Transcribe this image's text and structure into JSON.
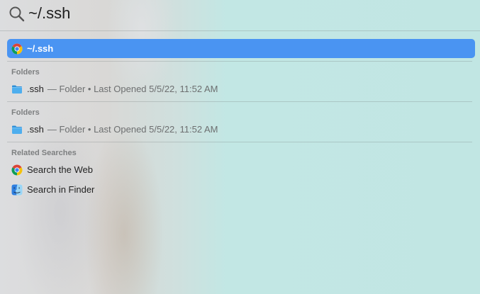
{
  "search": {
    "query": "~/.ssh",
    "icon": "magnifier"
  },
  "top_hit": {
    "label": "~/.ssh",
    "icon": "chrome",
    "selected": true
  },
  "sections": [
    {
      "header": "Folders",
      "item": {
        "name": ".ssh",
        "meta": "— Folder • Last Opened 5/5/22, 11:52 AM",
        "icon": "folder"
      }
    },
    {
      "header": "Folders",
      "item": {
        "name": ".ssh",
        "meta": "— Folder • Last Opened 5/5/22, 11:52 AM",
        "icon": "folder"
      }
    }
  ],
  "related": {
    "header": "Related Searches",
    "items": [
      {
        "label": "Search the Web",
        "icon": "chrome"
      },
      {
        "label": "Search in Finder",
        "icon": "finder"
      }
    ]
  },
  "colors": {
    "selection": "#4a94f2",
    "folder": "#3fa2e6",
    "background": "#c1e6e3"
  }
}
